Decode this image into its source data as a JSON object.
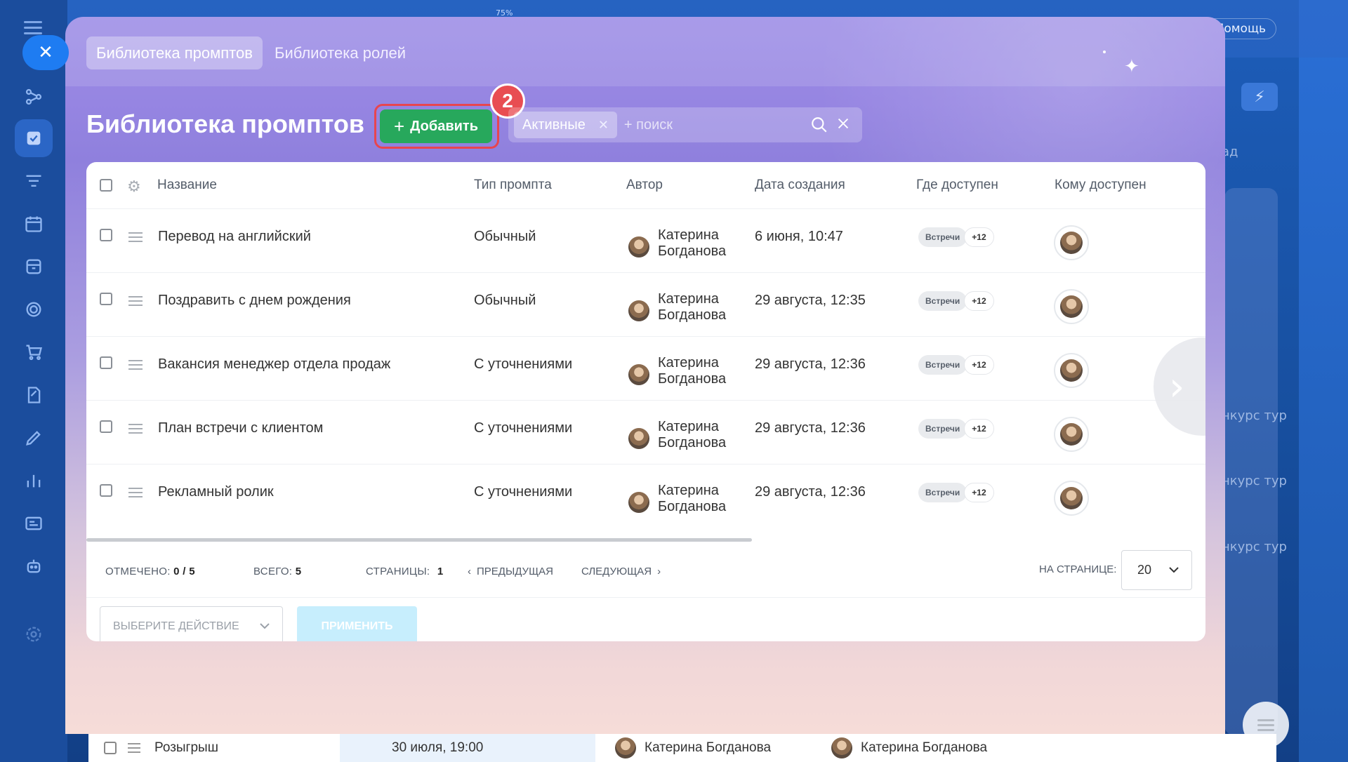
{
  "background": {
    "zoom": "75%",
    "help": "Помощь",
    "right_texts": [
      "ад",
      "нкурс тур",
      "нкурс тур",
      "нкурс тур"
    ],
    "row": {
      "name": "Розыгрыш",
      "date": "30 июля, 19:00",
      "person1": "Катерина Богданова",
      "person2": "Катерина Богданова"
    }
  },
  "modal": {
    "tabs": [
      {
        "label": "Библиотека промптов",
        "active": true
      },
      {
        "label": "Библиотека ролей",
        "active": false
      }
    ],
    "title": "Библиотека промптов",
    "add_button": "Добавить",
    "step_badge": "2",
    "filter_chip": "Активные",
    "search_placeholder": "+ поиск"
  },
  "table": {
    "columns": [
      "Название",
      "Тип промпта",
      "Автор",
      "Дата создания",
      "Где доступен",
      "Кому доступен"
    ],
    "rows": [
      {
        "name": "Перевод на английский",
        "type": "Обычный",
        "author": [
          "Катерина",
          "Богданова"
        ],
        "date": "6 июня, 10:47",
        "where": "Встречи",
        "more": "+12"
      },
      {
        "name": "Поздравить с днем рождения",
        "type": "Обычный",
        "author": [
          "Катерина",
          "Богданова"
        ],
        "date": "29 августа, 12:35",
        "where": "Встречи",
        "more": "+12"
      },
      {
        "name": "Вакансия менеджер отдела продаж",
        "type": "С уточнениями",
        "author": [
          "Катерина",
          "Богданова"
        ],
        "date": "29 августа, 12:36",
        "where": "Встречи",
        "more": "+12"
      },
      {
        "name": "План встречи с клиентом",
        "type": "С уточнениями",
        "author": [
          "Катерина",
          "Богданова"
        ],
        "date": "29 августа, 12:36",
        "where": "Встречи",
        "more": "+12"
      },
      {
        "name": "Рекламный ролик",
        "type": "С уточнениями",
        "author": [
          "Катерина",
          "Богданова"
        ],
        "date": "29 августа, 12:36",
        "where": "Встречи",
        "more": "+12"
      }
    ]
  },
  "footer": {
    "checked_label": "Отмечено:",
    "checked_value": "0 / 5",
    "total_label": "Всего:",
    "total_value": "5",
    "pages_label": "Страницы:",
    "pages_value": "1",
    "prev": "Предыдущая",
    "next": "Следующая",
    "per_page_label": "На странице:",
    "per_page_value": "20"
  },
  "actions": {
    "select_placeholder": "Выберите действие",
    "apply": "Применить"
  },
  "colors": {
    "add_button": "#27a85c",
    "highlight": "#e8454f",
    "apply_disabled": "#c7eefd"
  }
}
